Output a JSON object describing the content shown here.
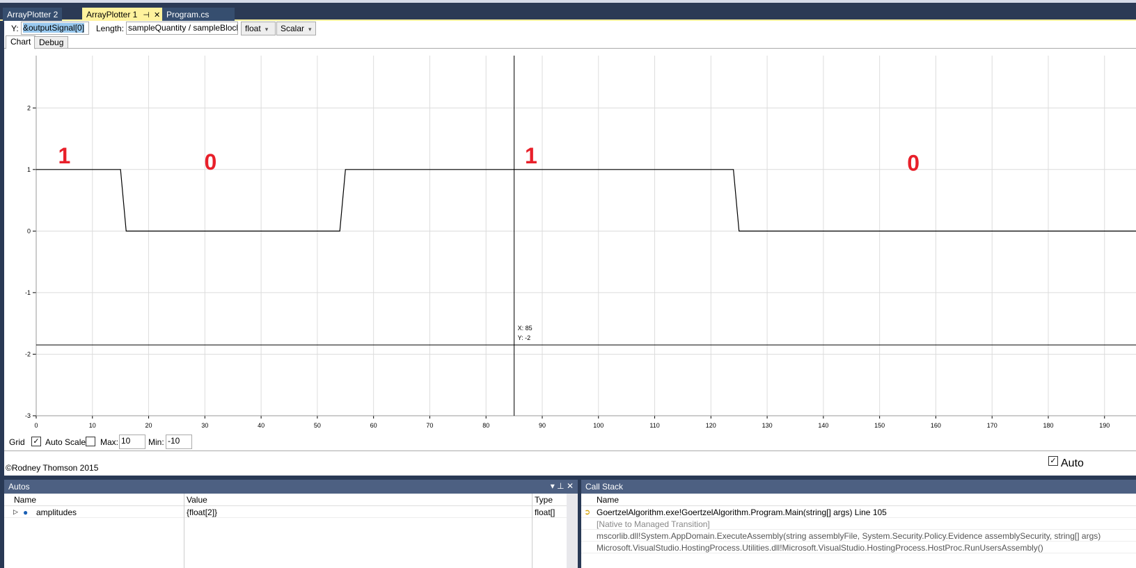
{
  "tabs": [
    {
      "label": "ArrayPlotter 2"
    },
    {
      "label": "ArrayPlotter 1",
      "pin": "pin-icon",
      "close": "close-icon"
    },
    {
      "label": "Program.cs"
    }
  ],
  "toolbar": {
    "y_label": "Y:",
    "y_value": "&outputSignal[0]",
    "length_label": "Length:",
    "length_value": "sampleQuantity / sampleBlock",
    "type_select": "float",
    "mode_select": "Scalar"
  },
  "chart_tabs": [
    {
      "label": "Chart"
    },
    {
      "label": "Debug"
    }
  ],
  "chart_data": {
    "type": "line",
    "xlim": [
      0,
      195.6
    ],
    "ylim": [
      -3,
      2.85
    ],
    "x_ticks": [
      0,
      10,
      20,
      30,
      40,
      50,
      60,
      70,
      80,
      90,
      100,
      110,
      120,
      130,
      140,
      150,
      160,
      170,
      180,
      190
    ],
    "y_ticks": [
      2,
      1,
      0,
      -1,
      -2,
      -3
    ],
    "grid": true,
    "series": [
      {
        "color": "#000000",
        "runs": [
          {
            "from": 0,
            "to": 15,
            "value": 1
          },
          {
            "from": 16,
            "to": 54,
            "value": 0
          },
          {
            "from": 55,
            "to": 124,
            "value": 1
          },
          {
            "from": 125,
            "to": 196,
            "value": 0
          }
        ]
      }
    ],
    "cursor": {
      "x": 85,
      "y": -1.85,
      "readout_x": "X: 85",
      "readout_y": "Y: -2"
    },
    "annotations": [
      {
        "text": "1",
        "x": 5,
        "y": 1.1
      },
      {
        "text": "0",
        "x": 31,
        "y": 1.0
      },
      {
        "text": "1",
        "x": 88,
        "y": 1.1
      },
      {
        "text": "0",
        "x": 156,
        "y": 0.98
      }
    ],
    "annotation_color": "#e8202a"
  },
  "controls": {
    "grid_label": "Grid",
    "grid_checked": true,
    "autoscale_label": "Auto Scale",
    "autoscale_checked": false,
    "max_label": "Max:",
    "max_value": "10",
    "min_label": "Min:",
    "min_value": "-10"
  },
  "footer": {
    "copyright": "©Rodney Thomson 2015",
    "auto_label": "Auto",
    "auto_checked": true
  },
  "autos": {
    "title": "Autos",
    "columns": [
      "Name",
      "Value",
      "Type"
    ],
    "rows": [
      {
        "name": "amplitudes",
        "value": "{float[2]}",
        "type": "float[]"
      }
    ]
  },
  "callstack": {
    "title": "Call Stack",
    "column": "Name",
    "rows": [
      {
        "text": "GoertzelAlgorithm.exe!GoertzelAlgorithm.Program.Main(string[] args) Line 105",
        "current": true
      },
      {
        "text": "[Native to Managed Transition]",
        "grey": true
      },
      {
        "text": "mscorlib.dll!System.AppDomain.ExecuteAssembly(string assemblyFile, System.Security.Policy.Evidence assemblySecurity, string[] args)"
      },
      {
        "text": "Microsoft.VisualStudio.HostingProcess.Utilities.dll!Microsoft.VisualStudio.HostingProcess.HostProc.RunUsersAssembly()"
      }
    ]
  }
}
